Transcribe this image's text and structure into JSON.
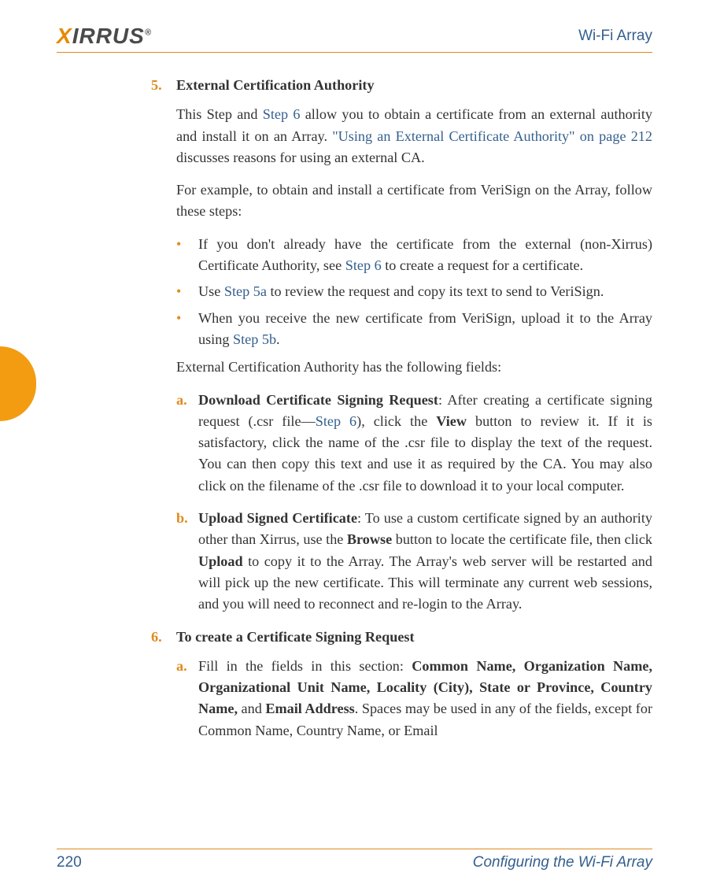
{
  "header": {
    "logo_text_prefix": "X",
    "logo_text_rest": "IRRUS",
    "reg": "®",
    "right": "Wi-Fi Array"
  },
  "section5": {
    "num": "5.",
    "title": "External Certification Authority",
    "p1_a": "This Step and ",
    "p1_link1": "Step 6",
    "p1_b": " allow you to obtain a certificate from an external authority and install it on an Array. ",
    "p1_link2": "\"Using an External Certificate Authority\" on page 212",
    "p1_c": " discusses reasons for using an external CA.",
    "p2": "For example, to obtain and install a certificate from VeriSign on the Array, follow these steps:",
    "bullets": [
      {
        "a": "If you don't already have the certificate from the external (non-Xirrus) Certificate Authority, see ",
        "link": "Step 6",
        "b": " to create a request for a certificate."
      },
      {
        "a": "Use ",
        "link": "Step 5a",
        "b": " to review the request and copy its text to send to VeriSign."
      },
      {
        "a": "When you receive the new certificate from VeriSign, upload it to the Array using ",
        "link": "Step 5b",
        "b": "."
      }
    ],
    "p3": "External Certification Authority has the following fields:",
    "sub_a": {
      "label": "a.",
      "bold": "Download Certificate Signing Request",
      "t1": ": After creating a certificate signing request (.csr file—",
      "link": "Step 6",
      "t2": "), click the ",
      "bold2": "View",
      "t3": " button to review it. If it is satisfactory, click the name of the .csr file to display the text of the request. You can then copy this text and use it as required by the CA. You may also click on the filename of the .csr file to download it to your local computer."
    },
    "sub_b": {
      "label": "b.",
      "bold": "Upload Signed Certificate",
      "t1": ": To use a custom certificate signed by an authority other than Xirrus, use the ",
      "bold2": "Browse",
      "t2": " button to locate the certificate file, then click ",
      "bold3": "Upload",
      "t3": " to copy it to the Array. The Array's web server will be restarted and will pick up the new certificate. This will terminate any current web sessions, and you will need to reconnect and re-login to the Array."
    }
  },
  "section6": {
    "num": "6.",
    "title": "To create a Certificate Signing Request",
    "sub_a": {
      "label": "a.",
      "t1": "Fill in the fields in this section: ",
      "bold1": "Common Name, Organization Name, Organizational Unit Name, Locality (City), State or Province, Country Name,",
      "t2": " and ",
      "bold2": "Email Address",
      "t3": ". Spaces may be used in any of the fields, except for Common Name, Country Name, or Email"
    }
  },
  "footer": {
    "page": "220",
    "section": "Configuring the Wi-Fi Array"
  }
}
